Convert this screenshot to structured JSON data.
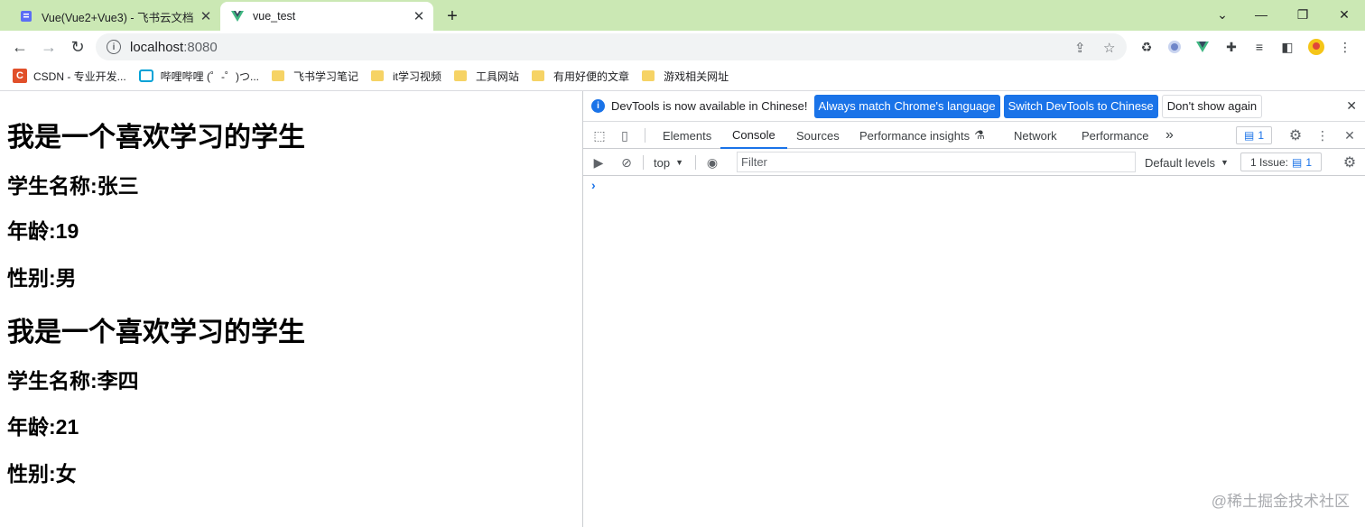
{
  "browser": {
    "tabs": [
      {
        "title": "Vue(Vue2+Vue3) - 飞书云文档",
        "close": "✕"
      },
      {
        "title": "vue_test",
        "close": "✕"
      }
    ],
    "new_tab": "+",
    "window_controls": {
      "minimize": "⌄",
      "restore": "—",
      "maximize": "❐",
      "close": "✕"
    },
    "nav": {
      "back": "←",
      "forward": "→",
      "reload": "↻"
    },
    "address": {
      "host": "localhost",
      "port": ":8080"
    },
    "bookmarks": [
      {
        "label": "CSDN - 专业开发...",
        "icon": "csdn-icon",
        "icon_text": "C"
      },
      {
        "label": "哔哩哔哩 (゜-゜)つ...",
        "icon": "bilibili-icon"
      },
      {
        "label": "飞书学习笔记",
        "icon": "folder-icon"
      },
      {
        "label": "it学习视频",
        "icon": "folder-icon"
      },
      {
        "label": "工具网站",
        "icon": "folder-icon"
      },
      {
        "label": "有用好便的文章",
        "icon": "folder-icon"
      },
      {
        "label": "游戏相关网址",
        "icon": "folder-icon"
      }
    ]
  },
  "page": {
    "students": [
      {
        "heading": "我是一个喜欢学习的学生",
        "name": "学生名称:张三",
        "age": "年龄:19",
        "gender": "性别:男"
      },
      {
        "heading": "我是一个喜欢学习的学生",
        "name": "学生名称:李四",
        "age": "年龄:21",
        "gender": "性别:女"
      }
    ]
  },
  "devtools": {
    "infobar": {
      "message": "DevTools is now available in Chinese!",
      "btn_match": "Always match Chrome's language",
      "btn_switch": "Switch DevTools to Chinese",
      "btn_dismiss": "Don't show again"
    },
    "tabs": {
      "elements": "Elements",
      "console": "Console",
      "sources": "Sources",
      "perf_insights": "Performance insights",
      "network": "Network",
      "performance": "Performance",
      "more": "»"
    },
    "message_count": "1",
    "console": {
      "context": "top",
      "filter_placeholder": "Filter",
      "levels": "Default levels",
      "issues_label": "1 Issue:",
      "issues_count": "1",
      "prompt": "›"
    }
  },
  "watermark": "@稀土掘金技术社区",
  "colors": {
    "tabstrip": "#cbe8b4",
    "accent": "#1a73e8"
  }
}
